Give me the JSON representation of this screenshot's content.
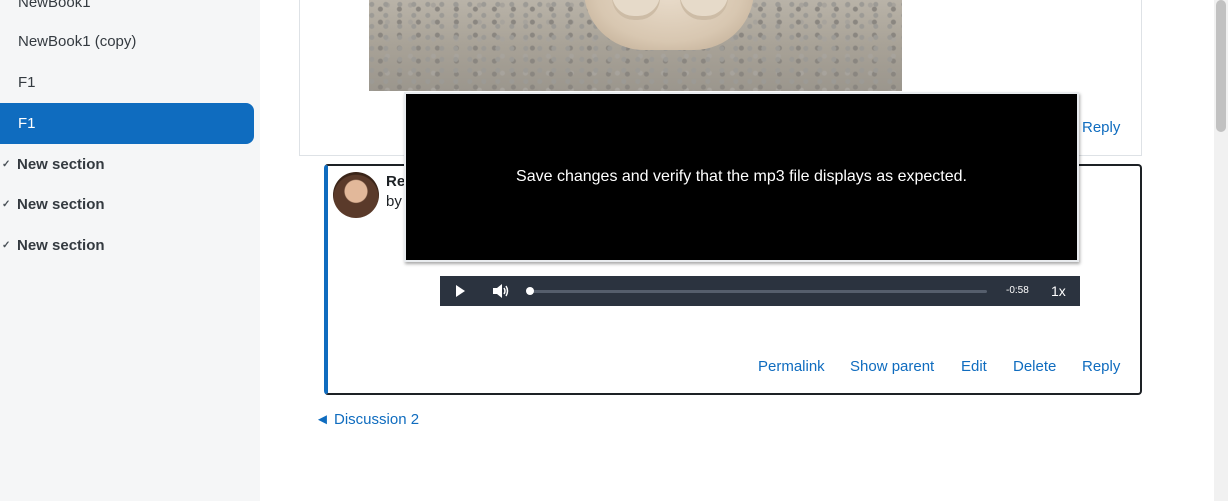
{
  "sidebar": {
    "items": [
      {
        "label": "NewBook1"
      },
      {
        "label": "NewBook1 (copy)"
      },
      {
        "label": "F1"
      },
      {
        "label": "F1"
      }
    ],
    "sections": [
      {
        "label": "New section"
      },
      {
        "label": "New section"
      },
      {
        "label": "New section"
      }
    ]
  },
  "post": {
    "reply_label": "Reply"
  },
  "reply_post": {
    "author_partial": "Re",
    "by_partial": "by",
    "actions": {
      "permalink": "Permalink",
      "show_parent": "Show parent",
      "edit": "Edit",
      "delete": "Delete",
      "reply": "Reply"
    }
  },
  "overlay": {
    "text": "Save changes and verify that the mp3 file displays as expected."
  },
  "player": {
    "time_remaining": "-0:58",
    "speed": "1x",
    "progress": 0.0
  },
  "nav": {
    "prev_discussion": "◄ Discussion 2"
  }
}
